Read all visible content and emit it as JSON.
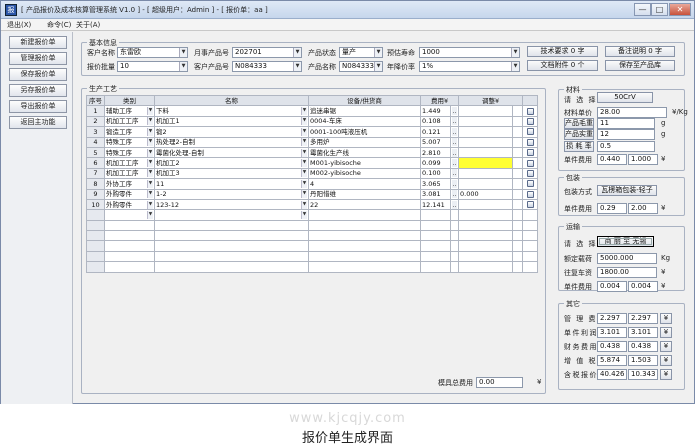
{
  "window": {
    "title": "[ 产品报价及成本核算管理系统 V1.0 ] - [ 超级用户：Admin ] - [ 报价单：aa ]",
    "minimize_glyph": "—",
    "maximize_glyph": "□",
    "close_glyph": "✕",
    "app_icon_glyph": "报"
  },
  "menu": [
    "退出(X)",
    "命令(C)",
    "关于(A)"
  ],
  "sidebar": [
    "新建报价单",
    "管理报价单",
    "保存报价单",
    "另存报价单",
    "导出报价单",
    "返回主功能"
  ],
  "basic": {
    "group": "基本信息",
    "customer_name_label": "客户名称",
    "customer_name": "东雷欧",
    "own_product_no_label": "月事产品号",
    "own_product_no": "202701",
    "product_status_label": "产品状态",
    "product_status": "量产",
    "estimate_qty_label": "预估寿命",
    "estimate_qty": "1000",
    "tech_req_button": "技术要求 0 字",
    "remark_button": "备注说明 0 字",
    "quote_batch_label": "报价批量",
    "quote_batch": "10",
    "cust_product_no_label": "客户产品号",
    "cust_product_no": "N084333",
    "product_name_label": "产品名称",
    "product_name": "N084333主轴",
    "annual_rate_label": "年降价率",
    "annual_rate": "1%",
    "attachment_button": "文档附件 0 个",
    "save_product_button": "保存至产品库"
  },
  "process": {
    "group": "生产工艺",
    "columns": [
      "序号",
      "类别",
      "名称",
      "设备/供货商",
      "费用¥",
      "调整¥"
    ],
    "rows": [
      {
        "no": "1",
        "category": "辅助工序",
        "name": "下料",
        "equipment": "追迷串锯",
        "cost": "1.449",
        "adjust": "",
        "hl": false
      },
      {
        "no": "2",
        "category": "机加工工序",
        "name": "机加工1",
        "equipment": "0004-车床",
        "cost": "0.108",
        "adjust": "",
        "hl": false
      },
      {
        "no": "3",
        "category": "锻造工序",
        "name": "锻2",
        "equipment": "0001-100吨液压机",
        "cost": "0.121",
        "adjust": "",
        "hl": false
      },
      {
        "no": "4",
        "category": "特殊工序",
        "name": "热处理2-自制",
        "equipment": "多用炉",
        "cost": "5.007",
        "adjust": "",
        "hl": false
      },
      {
        "no": "5",
        "category": "特殊工序",
        "name": "霉菌化处理-自制",
        "equipment": "霉菌化生产线",
        "cost": "2.810",
        "adjust": "",
        "hl": false
      },
      {
        "no": "6",
        "category": "机加工工序",
        "name": "机加工2",
        "equipment": "M001-yibisoche",
        "cost": "0.099",
        "adjust": "",
        "hl": true
      },
      {
        "no": "7",
        "category": "机加工工序",
        "name": "机加工3",
        "equipment": "M002-yibisoche",
        "cost": "0.100",
        "adjust": "",
        "hl": false
      },
      {
        "no": "8",
        "category": "外协工序",
        "name": "11",
        "equipment": "4",
        "cost": "3.065",
        "adjust": "",
        "hl": false
      },
      {
        "no": "9",
        "category": "外购零件",
        "name": "1-2",
        "equipment": "丹阳惜维",
        "cost": "3.081",
        "adjust": "0.000",
        "hl": false
      },
      {
        "no": "10",
        "category": "外购零件",
        "name": "123-12",
        "equipment": "22",
        "cost": "12.141",
        "adjust": "",
        "hl": false
      }
    ],
    "ellipsis": "..",
    "total_label": "模具总费用",
    "total_value": "0.00",
    "total_unit": "¥"
  },
  "material": {
    "group": "材料",
    "select_label": "请 选 择",
    "select_button": "50CrV",
    "unit_price_label": "材料单价",
    "unit_price": "28.00",
    "unit_price_unit": "¥/Kg",
    "gross_label": "产品毛重",
    "gross": "11",
    "gross_unit": "g",
    "net_label": "产品实重",
    "net": "12",
    "net_unit": "g",
    "loss_label": "损 耗 率",
    "loss": "0.5",
    "cost_label": "单件费用",
    "cost_a": "0.440",
    "cost_b": "1.000",
    "cost_unit": "¥"
  },
  "packing": {
    "group": "包装",
    "method_label": "包装方式",
    "method_button": "瓦楞箱包装-轻子",
    "cost_label": "单件费用",
    "cost_a": "0.29",
    "cost_b": "2.00",
    "cost_unit": "¥"
  },
  "transport": {
    "group": "运输",
    "select_label": "请 选 择",
    "select_button": "商 丽 至 无锡",
    "load_label": "额定载荷",
    "load": "5000.000",
    "load_unit": "Kg",
    "fare_label": "往复车资",
    "fare": "1800.00",
    "fare_unit": "¥",
    "cost_label": "单件费用",
    "cost_a": "0.004",
    "cost_b": "0.004",
    "cost_unit": "¥"
  },
  "other": {
    "group": "其它",
    "rows": [
      {
        "label": "管 理 费",
        "a": "2.297",
        "b": "2.297",
        "unit": "¥"
      },
      {
        "label": "单件利润",
        "a": "3.101",
        "b": "3.101",
        "unit": "¥"
      },
      {
        "label": "财务费用",
        "a": "0.438",
        "b": "0.438",
        "unit": "¥"
      },
      {
        "label": "增 值 税",
        "a": "5.874",
        "b": "1.503",
        "unit": "¥"
      },
      {
        "label": "含税报价",
        "a": "40.426",
        "b": "10.343",
        "unit": "¥"
      }
    ]
  },
  "watermark": "www.kjcqjy.com",
  "caption": "报价单生成界面"
}
